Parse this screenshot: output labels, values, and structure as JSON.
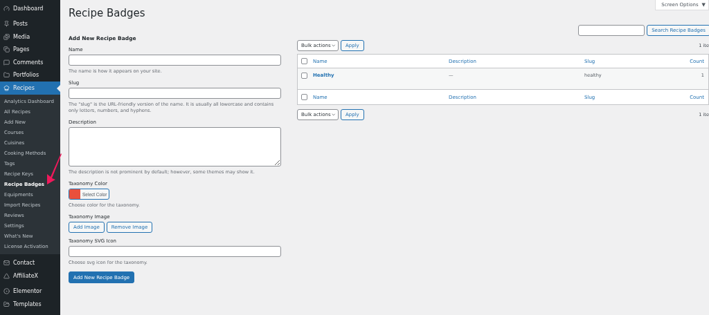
{
  "sidebar": {
    "groups": [
      [
        {
          "label": "Dashboard",
          "selected": false
        }
      ],
      [
        {
          "label": "Posts",
          "selected": false
        },
        {
          "label": "Media",
          "selected": false
        },
        {
          "label": "Pages",
          "selected": false
        },
        {
          "label": "Comments",
          "selected": false
        },
        {
          "label": "Portfolios",
          "selected": false
        },
        {
          "label": "Recipes",
          "selected": true,
          "children": [
            {
              "label": "Analytics Dashboard",
              "selected": false
            },
            {
              "label": "All Recipes",
              "selected": false
            },
            {
              "label": "Add New",
              "selected": false
            },
            {
              "label": "Courses",
              "selected": false
            },
            {
              "label": "Cuisines",
              "selected": false
            },
            {
              "label": "Cooking Methods",
              "selected": false
            },
            {
              "label": "Tags",
              "selected": false
            },
            {
              "label": "Recipe Keys",
              "selected": false
            },
            {
              "label": "Recipe Badges",
              "selected": true
            },
            {
              "label": "Equipments",
              "selected": false
            },
            {
              "label": "Import Recipes",
              "selected": false
            },
            {
              "label": "Reviews",
              "selected": false
            },
            {
              "label": "Settings",
              "selected": false
            },
            {
              "label": "What's New",
              "selected": false
            },
            {
              "label": "License Activation",
              "selected": false
            }
          ]
        }
      ],
      [
        {
          "label": "Contact",
          "selected": false
        },
        {
          "label": "AffiliateX",
          "selected": false
        }
      ],
      [
        {
          "label": "Elementor",
          "selected": false
        },
        {
          "label": "Templates",
          "selected": false
        }
      ]
    ]
  },
  "page": {
    "title": "Recipe Badges",
    "screen_options": "Screen Options",
    "screen_options_caret": "▼"
  },
  "form": {
    "heading": "Add New Recipe Badge",
    "fields": [
      {
        "kind": "text",
        "label": "Name",
        "hint": "The name is how it appears on your site."
      },
      {
        "kind": "text",
        "label": "Slug",
        "hint": "The \"slug\" is the URL-friendly version of the name. It is usually all lowercase and contains only letters, numbers, and hyphens."
      },
      {
        "kind": "textarea",
        "label": "Description",
        "hint": "The description is not prominent by default; however, some themes may show it."
      },
      {
        "kind": "color",
        "label": "Taxonomy Color",
        "button": "Select Color",
        "color": "#e9503c",
        "hint": "Choose color for the taxonomy."
      },
      {
        "kind": "buttons",
        "label": "Taxonomy Image",
        "buttons": [
          "Add Image",
          "Remove Image"
        ]
      },
      {
        "kind": "text",
        "label": "Taxonomy SVG Icon",
        "hint": "Choose svg icon for the taxonomy."
      }
    ],
    "submit": "Add New Recipe Badge"
  },
  "list": {
    "search_button": "Search Recipe Badges",
    "top_actions": {
      "bulk": "Bulk actions",
      "apply": "Apply",
      "count": "1 ite"
    },
    "bottom_actions": {
      "bulk": "Bulk actions",
      "apply": "Apply",
      "count": "1 ite"
    },
    "columns": [
      "Name",
      "Description",
      "Slug",
      "Count"
    ],
    "header_checked": false,
    "rows": [
      {
        "name": "Healthy",
        "description": "—",
        "slug": "healthy",
        "count": "1",
        "checked": false
      }
    ],
    "footer_columns": [
      "Name",
      "Description",
      "Slug",
      "Count"
    ],
    "footer_checked": false
  }
}
